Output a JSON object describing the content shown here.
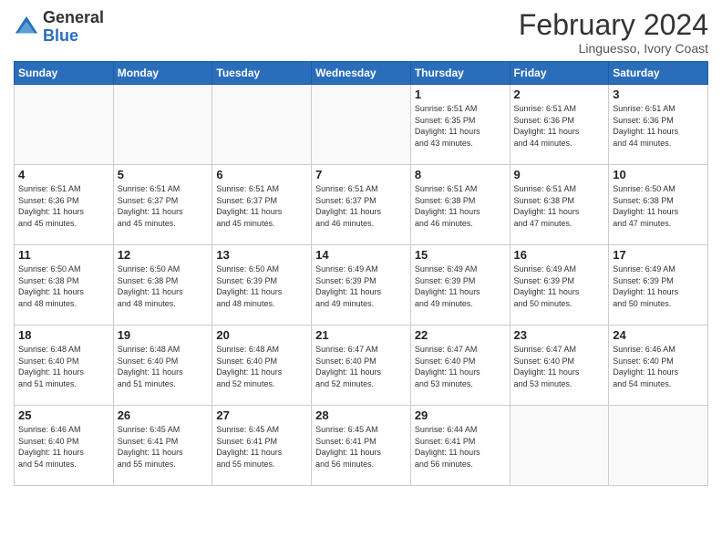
{
  "header": {
    "logo_general": "General",
    "logo_blue": "Blue",
    "month_year": "February 2024",
    "location": "Linguesso, Ivory Coast"
  },
  "days_of_week": [
    "Sunday",
    "Monday",
    "Tuesday",
    "Wednesday",
    "Thursday",
    "Friday",
    "Saturday"
  ],
  "weeks": [
    [
      {
        "day": "",
        "info": ""
      },
      {
        "day": "",
        "info": ""
      },
      {
        "day": "",
        "info": ""
      },
      {
        "day": "",
        "info": ""
      },
      {
        "day": "1",
        "info": "Sunrise: 6:51 AM\nSunset: 6:35 PM\nDaylight: 11 hours\nand 43 minutes."
      },
      {
        "day": "2",
        "info": "Sunrise: 6:51 AM\nSunset: 6:36 PM\nDaylight: 11 hours\nand 44 minutes."
      },
      {
        "day": "3",
        "info": "Sunrise: 6:51 AM\nSunset: 6:36 PM\nDaylight: 11 hours\nand 44 minutes."
      }
    ],
    [
      {
        "day": "4",
        "info": "Sunrise: 6:51 AM\nSunset: 6:36 PM\nDaylight: 11 hours\nand 45 minutes."
      },
      {
        "day": "5",
        "info": "Sunrise: 6:51 AM\nSunset: 6:37 PM\nDaylight: 11 hours\nand 45 minutes."
      },
      {
        "day": "6",
        "info": "Sunrise: 6:51 AM\nSunset: 6:37 PM\nDaylight: 11 hours\nand 45 minutes."
      },
      {
        "day": "7",
        "info": "Sunrise: 6:51 AM\nSunset: 6:37 PM\nDaylight: 11 hours\nand 46 minutes."
      },
      {
        "day": "8",
        "info": "Sunrise: 6:51 AM\nSunset: 6:38 PM\nDaylight: 11 hours\nand 46 minutes."
      },
      {
        "day": "9",
        "info": "Sunrise: 6:51 AM\nSunset: 6:38 PM\nDaylight: 11 hours\nand 47 minutes."
      },
      {
        "day": "10",
        "info": "Sunrise: 6:50 AM\nSunset: 6:38 PM\nDaylight: 11 hours\nand 47 minutes."
      }
    ],
    [
      {
        "day": "11",
        "info": "Sunrise: 6:50 AM\nSunset: 6:38 PM\nDaylight: 11 hours\nand 48 minutes."
      },
      {
        "day": "12",
        "info": "Sunrise: 6:50 AM\nSunset: 6:38 PM\nDaylight: 11 hours\nand 48 minutes."
      },
      {
        "day": "13",
        "info": "Sunrise: 6:50 AM\nSunset: 6:39 PM\nDaylight: 11 hours\nand 48 minutes."
      },
      {
        "day": "14",
        "info": "Sunrise: 6:49 AM\nSunset: 6:39 PM\nDaylight: 11 hours\nand 49 minutes."
      },
      {
        "day": "15",
        "info": "Sunrise: 6:49 AM\nSunset: 6:39 PM\nDaylight: 11 hours\nand 49 minutes."
      },
      {
        "day": "16",
        "info": "Sunrise: 6:49 AM\nSunset: 6:39 PM\nDaylight: 11 hours\nand 50 minutes."
      },
      {
        "day": "17",
        "info": "Sunrise: 6:49 AM\nSunset: 6:39 PM\nDaylight: 11 hours\nand 50 minutes."
      }
    ],
    [
      {
        "day": "18",
        "info": "Sunrise: 6:48 AM\nSunset: 6:40 PM\nDaylight: 11 hours\nand 51 minutes."
      },
      {
        "day": "19",
        "info": "Sunrise: 6:48 AM\nSunset: 6:40 PM\nDaylight: 11 hours\nand 51 minutes."
      },
      {
        "day": "20",
        "info": "Sunrise: 6:48 AM\nSunset: 6:40 PM\nDaylight: 11 hours\nand 52 minutes."
      },
      {
        "day": "21",
        "info": "Sunrise: 6:47 AM\nSunset: 6:40 PM\nDaylight: 11 hours\nand 52 minutes."
      },
      {
        "day": "22",
        "info": "Sunrise: 6:47 AM\nSunset: 6:40 PM\nDaylight: 11 hours\nand 53 minutes."
      },
      {
        "day": "23",
        "info": "Sunrise: 6:47 AM\nSunset: 6:40 PM\nDaylight: 11 hours\nand 53 minutes."
      },
      {
        "day": "24",
        "info": "Sunrise: 6:46 AM\nSunset: 6:40 PM\nDaylight: 11 hours\nand 54 minutes."
      }
    ],
    [
      {
        "day": "25",
        "info": "Sunrise: 6:46 AM\nSunset: 6:40 PM\nDaylight: 11 hours\nand 54 minutes."
      },
      {
        "day": "26",
        "info": "Sunrise: 6:45 AM\nSunset: 6:41 PM\nDaylight: 11 hours\nand 55 minutes."
      },
      {
        "day": "27",
        "info": "Sunrise: 6:45 AM\nSunset: 6:41 PM\nDaylight: 11 hours\nand 55 minutes."
      },
      {
        "day": "28",
        "info": "Sunrise: 6:45 AM\nSunset: 6:41 PM\nDaylight: 11 hours\nand 56 minutes."
      },
      {
        "day": "29",
        "info": "Sunrise: 6:44 AM\nSunset: 6:41 PM\nDaylight: 11 hours\nand 56 minutes."
      },
      {
        "day": "",
        "info": ""
      },
      {
        "day": "",
        "info": ""
      }
    ]
  ]
}
